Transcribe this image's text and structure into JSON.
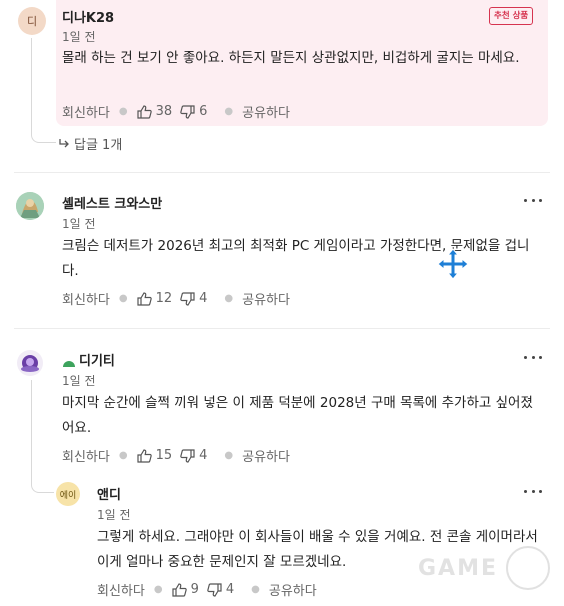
{
  "comments": [
    {
      "avatar_text": "디",
      "author": "디나K28",
      "badge": "추천 상품",
      "time": "1일 전",
      "body": "몰래 하는 건 보기 안 좋아요. 하든지 말든지 상관없지만, 비겁하게 굴지는 마세요.",
      "reply_label": "회신하다",
      "likes": "38",
      "dislikes": "6",
      "share_label": "공유하다",
      "replies_label": "답글 1개"
    },
    {
      "author": "셸레스트 크와스만",
      "time": "1일 전",
      "body": "크림슨 데저트가 2026년 최고의 최적화 PC 게임이라고 가정한다면, 문제없을 겁니다.",
      "reply_label": "회신하다",
      "likes": "12",
      "dislikes": "4",
      "share_label": "공유하다"
    },
    {
      "author": "디기티",
      "time": "1일 전",
      "body": "마지막 순간에 슬쩍 끼워 넣은 이 제품 덕분에 2028년 구매 목록에 추가하고 싶어졌어요.",
      "reply_label": "회신하다",
      "likes": "15",
      "dislikes": "4",
      "share_label": "공유하다"
    },
    {
      "avatar_text": "에이",
      "author": "앤디",
      "time": "1일 전",
      "body": "그렇게 하세요. 그래야만 이 회사들이 배울 수 있을 거예요. 전 콘솔 게이머라서 이게 얼마나 중요한 문제인지 잘 모르겠네요.",
      "reply_label": "회신하다",
      "likes": "9",
      "dislikes": "4",
      "share_label": "공유하다"
    }
  ],
  "watermark": "GAME",
  "colors": {
    "highlight_bg": "#fdeef2",
    "badge": "#d6334f",
    "move_cursor": "#1e7fd6",
    "muted": "#666666"
  }
}
